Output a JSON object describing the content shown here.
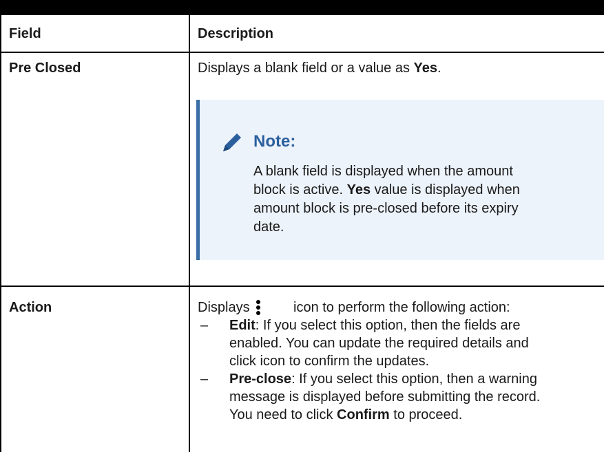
{
  "table": {
    "headers": {
      "field": "Field",
      "description": "Description"
    },
    "rows": [
      {
        "field": "Pre Closed",
        "desc_prefix": "Displays a blank field or a value as ",
        "desc_bold": "Yes",
        "desc_suffix": ".",
        "note": {
          "title": "Note:",
          "line1": "A blank field is displayed when the amount",
          "line2a": "block is active. ",
          "line2b": "Yes",
          "line2c": " value is displayed when",
          "line3": "amount block is pre-closed before its expiry",
          "line4": "date."
        }
      },
      {
        "field": "Action",
        "desc_prefix": "Displays",
        "desc_suffix": "icon to perform the following action:",
        "bullets": [
          {
            "dash": "–",
            "bold": "Edit",
            "text1": ": If you select this option, then the fields are",
            "text2": "enabled. You can update the required details and",
            "text3": "click icon to confirm the updates."
          },
          {
            "dash": "–",
            "bold": "Pre-close",
            "text1": ": If you select this option, then a warning",
            "text2": "message is displayed before submitting the record.",
            "text3a": "You need to click ",
            "text3b": "Confirm",
            "text3c": " to proceed."
          }
        ]
      }
    ]
  },
  "icons": {
    "note": "pencil-icon",
    "action": "kebab-menu-icon"
  },
  "colors": {
    "note_bg": "#edf3fb",
    "note_accent": "#3a6ea5",
    "note_title": "#2a5f9e"
  }
}
